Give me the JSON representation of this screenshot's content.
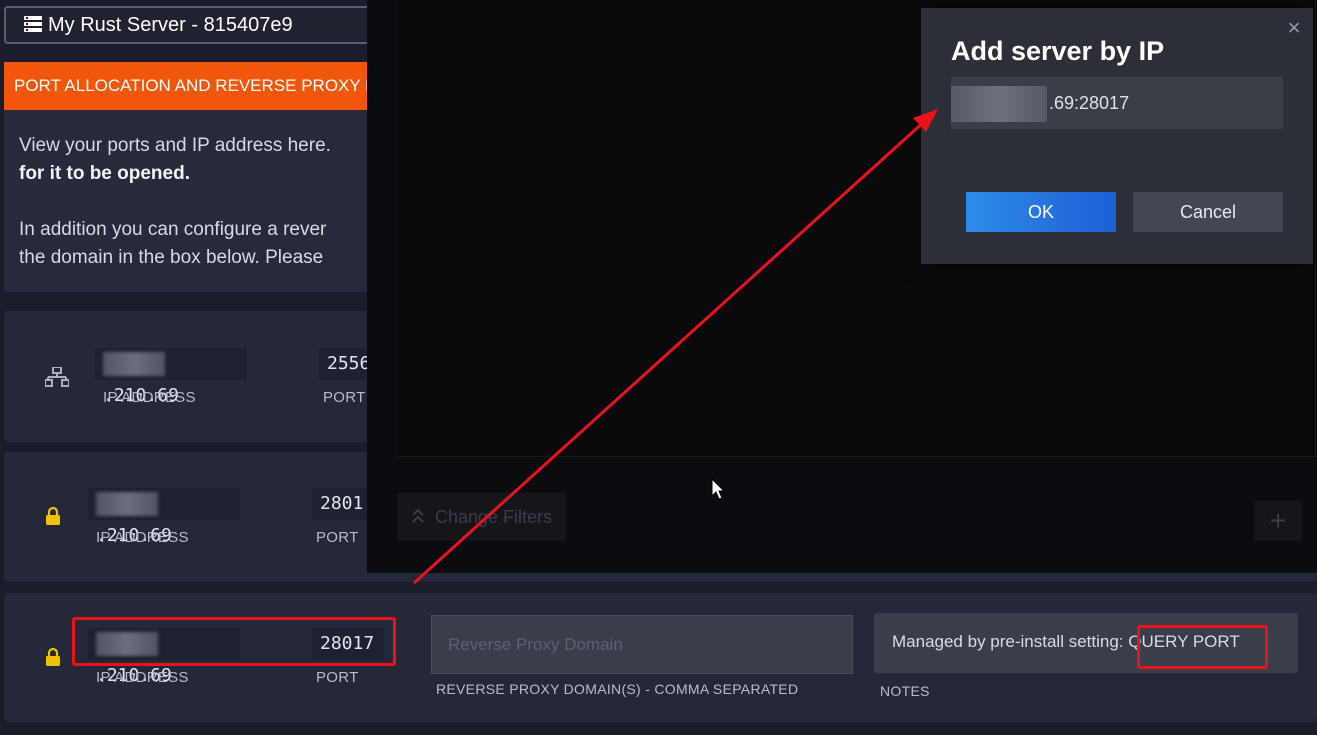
{
  "server": {
    "name": "My Rust Server - 815407e9"
  },
  "warning_bar": {
    "text": "PORT ALLOCATION AND REVERSE PROXY M"
  },
  "info": {
    "line1": "View your ports and IP address here.",
    "line1_bold": "for it to be opened.",
    "line2": "In addition you can configure a rever",
    "line3": "the domain in the box below. Please"
  },
  "rows": [
    {
      "icon": "network-icon",
      "ip": ".210.69",
      "ip_label": "IP ADDRESS",
      "port": "2556",
      "port_label": "PORT"
    },
    {
      "icon": "lock-icon",
      "ip": ".210.69",
      "ip_label": "IP ADDRESS",
      "port": "2801",
      "port_label": "PORT"
    },
    {
      "icon": "lock-icon",
      "ip": ".210.69",
      "ip_label": "IP ADDRESS",
      "port": "28017",
      "port_label": "PORT",
      "proxy_placeholder": "Reverse Proxy Domain",
      "proxy_label": "REVERSE PROXY DOMAIN(S) - COMMA SEPARATED",
      "notes_prefix": "Managed by pre-install setting:",
      "notes_highlight": " QUERY PORT",
      "notes_label": "NOTES"
    }
  ],
  "browser": {
    "change_filters": "Change Filters",
    "add": "+"
  },
  "dialog": {
    "title": "Add server by IP",
    "address_value": ".69:28017",
    "ok": "OK",
    "cancel": "Cancel",
    "close": "×"
  },
  "colors": {
    "accent_orange": "#f2560c",
    "highlight_red": "#e8141a",
    "ok_blue": "#2e8be8"
  }
}
